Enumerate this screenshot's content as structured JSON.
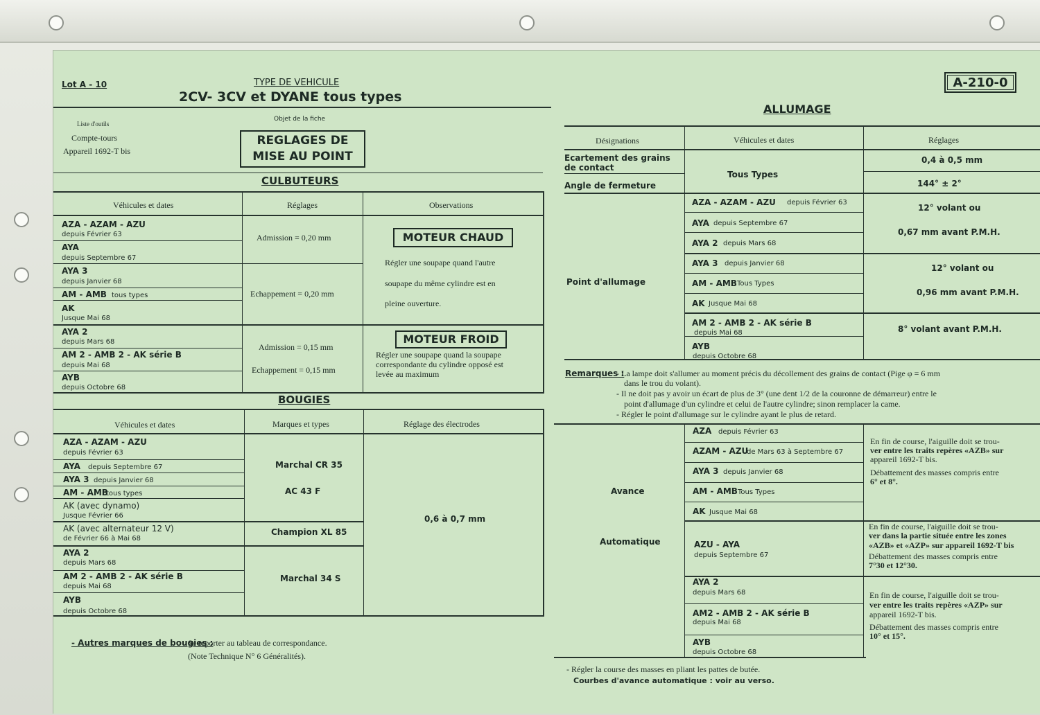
{
  "header": {
    "lot": "Lot A - 10",
    "type_label": "TYPE DE VEHICULE",
    "vehicle": "2CV- 3CV et DYANE tous types",
    "code": "A-210-0"
  },
  "tools": {
    "title": "Liste d'outils",
    "items": [
      "Compte-tours",
      "Appareil 1692-T bis"
    ]
  },
  "object": {
    "label": "Objet de la fiche",
    "title_l1": "REGLAGES DE",
    "title_l2": "MISE AU POINT"
  },
  "culbuteurs": {
    "title": "CULBUTEURS",
    "headers": [
      "Véhicules et dates",
      "Réglages",
      "Observations"
    ],
    "rows": [
      {
        "v": "AZA - AZAM - AZU",
        "d": "depuis Février 63"
      },
      {
        "v": "AYA",
        "d": "depuis Septembre 67"
      },
      {
        "v": "AYA 3",
        "d": "depuis Janvier 68"
      },
      {
        "v": "AM - AMB",
        "d": "tous types"
      },
      {
        "v": "AK",
        "d": "Jusque Mai 68"
      },
      {
        "v": "AYA 2",
        "d": "depuis Mars 68"
      },
      {
        "v": "AM 2 - AMB 2 - AK série B",
        "d": "depuis Mai 68"
      },
      {
        "v": "AYB",
        "d": "depuis Octobre 68"
      }
    ],
    "chaud_reglages": [
      "Admission = 0,20 mm",
      "Echappement = 0,20 mm"
    ],
    "froid_reglages": [
      "Admission = 0,15 mm",
      "Echappement = 0,15 mm"
    ],
    "chaud_title": "MOTEUR CHAUD",
    "chaud_text": [
      "Régler une soupape quand l'autre",
      "soupape du même cylindre est en",
      "pleine ouverture."
    ],
    "froid_title": "MOTEUR FROID",
    "froid_text": [
      "Régler une soupape quand la soupape",
      "correspondante du cylindre opposé est",
      "levée au maximum"
    ]
  },
  "bougies": {
    "title": "BOUGIES",
    "headers": [
      "Véhicules et dates",
      "Marques et types",
      "Réglage des électrodes"
    ],
    "rows": [
      {
        "v": "AZA - AZAM - AZU",
        "d": "depuis Février 63"
      },
      {
        "v": "AYA",
        "d": "depuis Septembre 67"
      },
      {
        "v": "AYA 3",
        "d": "depuis Janvier 68"
      },
      {
        "v": "AM - AMB",
        "d": "tous types"
      },
      {
        "v": "AK (avec dynamo)",
        "d": "Jusque Février 66"
      },
      {
        "v": "AK (avec alternateur 12 V)",
        "d": "de Février 66 à Mai 68"
      },
      {
        "v": "AYA 2",
        "d": "depuis Mars 68"
      },
      {
        "v": "AM 2 - AMB 2 - AK série B",
        "d": "depuis Mai 68"
      },
      {
        "v": "AYB",
        "d": "depuis Octobre 68"
      }
    ],
    "brands": [
      "Marchal CR 35",
      "AC 43 F",
      "Champion XL 85",
      "Marchal 34 S"
    ],
    "electrodes": "0,6 à 0,7 mm",
    "note_label": "- Autres marques de bougies :",
    "note_text": "Se reporter au tableau de correspondance.",
    "note_text2": "(Note Technique N° 6 Généralités)."
  },
  "allumage": {
    "title": "ALLUMAGE",
    "headers": [
      "Désignations",
      "Véhicules et dates",
      "Réglages"
    ],
    "ecart_label": "Ecartement des grains de contact",
    "ecart_val": "0,4 à 0,5 mm",
    "tous_types": "Tous Types",
    "angle_label": "Angle de fermeture",
    "angle_val": "144° ± 2°",
    "point_label": "Point d'allumage",
    "point_rows": [
      {
        "v": "AZA - AZAM - AZU",
        "d": "depuis Février 63"
      },
      {
        "v": "AYA",
        "d": "depuis Septembre 67"
      },
      {
        "v": "AYA 2",
        "d": "depuis Mars 68"
      },
      {
        "v": "AYA 3",
        "d": "depuis Janvier 68"
      },
      {
        "v": "AM - AMB",
        "d": "Tous Types"
      },
      {
        "v": "AK",
        "d": "Jusque Mai 68"
      },
      {
        "v": "AM 2 - AMB 2 - AK série B",
        "d": "depuis Mai 68"
      },
      {
        "v": "AYB",
        "d": "depuis Octobre 68"
      }
    ],
    "point_reg": [
      "12° volant ou",
      "0,67 mm avant P.M.H.",
      "12° volant ou",
      "0,96 mm avant P.M.H.",
      "8° volant avant P.M.H."
    ],
    "remarques_label": "Remarques :",
    "remarques": [
      "- La lampe doit s'allumer au moment précis du décollement des grains de contact (Pige φ = 6 mm",
      "dans le trou du volant).",
      "- Il ne doit pas y avoir un écart de plus de 3° (une dent 1/2 de la couronne de démarreur) entre le",
      "point d'allumage d'un cylindre et celui de l'autre cylindre; sinon remplacer la came.",
      "- Régler le point d'allumage sur le cylindre ayant le plus de retard."
    ],
    "avance_label": "Avance",
    "auto_label": "Automatique",
    "avance_rows": [
      {
        "v": "AZA",
        "d": "depuis Février 63"
      },
      {
        "v": "AZAM - AZU",
        "d": "de Mars 63 à Septembre 67"
      },
      {
        "v": "AYA 3",
        "d": "depuis Janvier 68"
      },
      {
        "v": "AM - AMB",
        "d": "Tous Types"
      },
      {
        "v": "AK",
        "d": "Jusque Mai 68"
      },
      {
        "v": "AZU - AYA",
        "d": "depuis Septembre 67"
      },
      {
        "v": "AYA 2",
        "d": "depuis Mars 68"
      },
      {
        "v": "AM2 - AMB 2 - AK série B",
        "d": "depuis Mai 68"
      },
      {
        "v": "AYB",
        "d": "depuis Octobre 68"
      }
    ],
    "avance_text1": [
      "En fin de course, l'aiguille doit se trou-",
      "ver entre les traits repères «AZB» sur",
      "appareil 1692-T bis.",
      "Débattement des masses compris entre",
      "6° et 8°."
    ],
    "avance_text2": [
      "En fin de course, l'aiguille doit se trou-",
      "ver dans la partie située entre les zones",
      "«AZB» et «AZP» sur appareil 1692-T bis",
      "Débattement des masses compris entre",
      "7°30 et 12°30."
    ],
    "avance_text3": [
      "En fin de course, l'aiguille doit se trou-",
      "ver entre les traits repères «AZP» sur",
      "appareil 1692-T bis.",
      "Débattement des masses compris entre",
      "10° et 15°."
    ],
    "footer": [
      "- Régler la course des masses en pliant les pattes de butée.",
      "Courbes d'avance automatique : voir au verso."
    ]
  }
}
